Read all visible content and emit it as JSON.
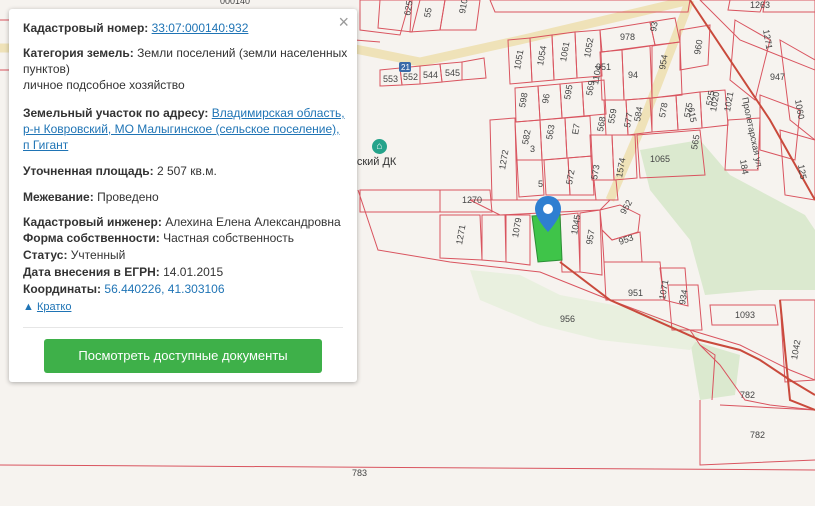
{
  "popup": {
    "close_label": "×",
    "cadastral_number_label": "Кадастровый номер:",
    "cadastral_number": "33:07:000140:932",
    "land_category_label": "Категория земель:",
    "land_category": "Земли поселений (земли населенных пунктов)",
    "land_use": "личное подсобное хозяйство",
    "address_label": "Земельный участок по адресу:",
    "address": "Владимирская область, р-н Ковровский, МО Малыгинское (сельское поселение), п Гигант",
    "area_label": "Уточненная площадь:",
    "area": "2 507 кв.м.",
    "survey_label": "Межевание:",
    "survey": "Проведено",
    "engineer_label": "Кадастровый инженер:",
    "engineer": "Алехина Елена Александровна",
    "ownership_label": "Форма собственности:",
    "ownership": "Частная собственность",
    "status_label": "Статус:",
    "status": "Учтенный",
    "egrn_date_label": "Дата внесения в ЕГРН:",
    "egrn_date": "14.01.2015",
    "coords_label": "Координаты:",
    "coords": "56.440226, 41.303106",
    "collapse_label": "Кратко",
    "docs_button": "Посмотреть доступные документы"
  },
  "map": {
    "poi_label": "нтовский ДК",
    "poi_icon": "landmark-icon",
    "street_label": "Пролетарская ул.",
    "road_badge": "21",
    "selected_color": "#3fc449",
    "parcel_color": "#d9545f",
    "green_color": "#dbe9cf",
    "parcel_labels": [
      "000140",
      "625",
      "55",
      "910",
      "1263",
      "978",
      "93",
      "960",
      "1271",
      "1051",
      "1054",
      "1061",
      "1052",
      "951",
      "954",
      "947",
      "1060",
      "553",
      "552",
      "544",
      "545",
      "1104",
      "94",
      "615",
      "525",
      "1021",
      "598",
      "96",
      "595",
      "569",
      "559",
      "584",
      "578",
      "575",
      "1020",
      "582",
      "563",
      "E7",
      "568",
      "577",
      "565",
      "184",
      "125",
      "1272",
      "3",
      "572",
      "573",
      "1574",
      "1065",
      "1270",
      "5",
      "952",
      "1271",
      "1079",
      "1045",
      "957",
      "953",
      "951",
      "1071",
      "934",
      "1093",
      "956",
      "1042",
      "782",
      "782",
      "783"
    ]
  }
}
